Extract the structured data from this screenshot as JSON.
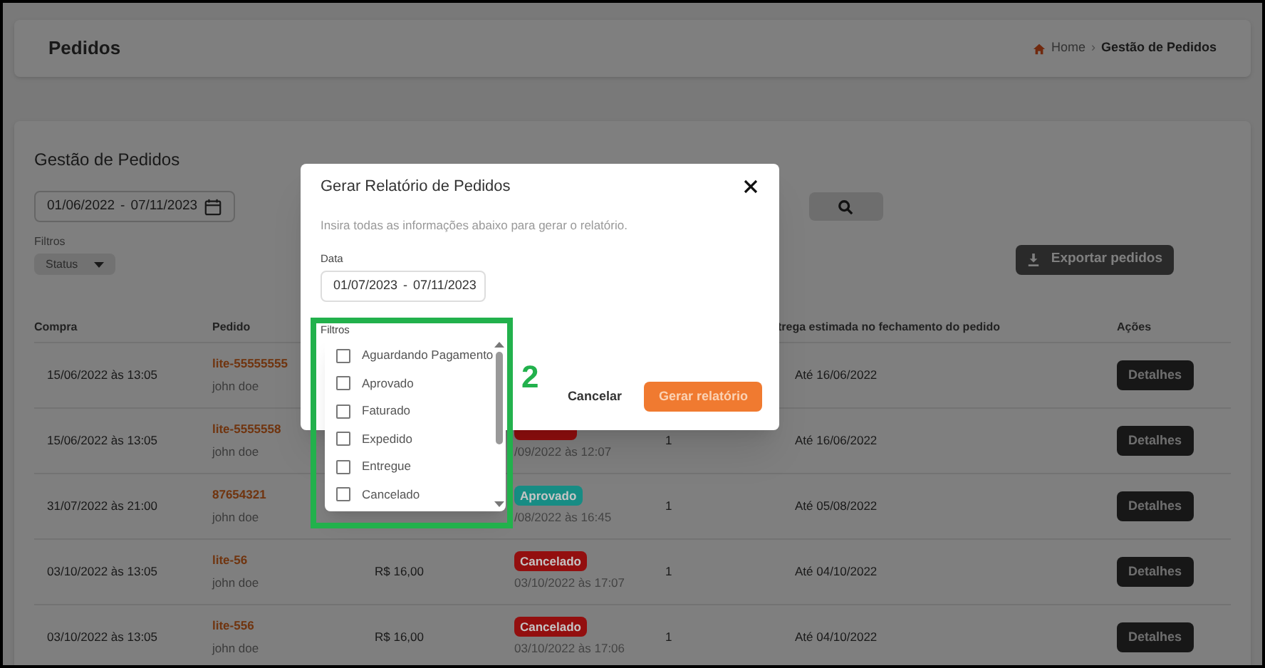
{
  "header": {
    "title": "Pedidos",
    "separator": "›",
    "breadcrumb": [
      {
        "label": "Home",
        "kind": "home"
      },
      {
        "label": "Gestão de Pedidos",
        "kind": "current"
      }
    ]
  },
  "orders": {
    "title": "Gestão de Pedidos",
    "date_range": {
      "start": "01/06/2022",
      "separator": "-",
      "end": "07/11/2023"
    },
    "filters_label": "Filtros",
    "status_select": "Status",
    "export_button": "Exportar pedidos",
    "columns": {
      "column_1": "Compra",
      "column_2": "Pedido",
      "column_6": "trega estimada no fechamento do pedido",
      "column_7": "Ações"
    },
    "rows": [
      {
        "date": "15/06/2022 às 13:05",
        "order": "lite-55555555",
        "customer": "john doe",
        "delivery": "Até 16/06/2022",
        "action": "Detalhes"
      },
      {
        "date": "15/06/2022 às 13:05",
        "order": "lite-5555558",
        "customer": "john doe",
        "status": {
          "color": "#930f0f",
          "date": "/09/2022 às 12:07"
        },
        "quantity": "1",
        "delivery": "Até 16/06/2022",
        "action": "Detalhes"
      },
      {
        "date": "31/07/2022 às 21:00",
        "order": "87654321",
        "customer": "john doe",
        "status": {
          "label": "Aprovado",
          "color": "#178c84",
          "date": "/08/2022 às 16:45"
        },
        "quantity": "1",
        "delivery": "Até 05/08/2022",
        "action": "Detalhes"
      },
      {
        "date": "03/10/2022 às 13:05",
        "order": "lite-56",
        "customer": "john doe",
        "price": "R$ 16,00",
        "status": {
          "label": "Cancelado",
          "color": "#930f0f",
          "date": "03/10/2022 às 17:07"
        },
        "quantity": "1",
        "delivery": "Até 04/10/2022",
        "action": "Detalhes"
      },
      {
        "date": "03/10/2022 às 13:05",
        "order": "lite-556",
        "customer": "john doe",
        "price": "R$ 16,00",
        "status": {
          "label": "Cancelado",
          "color": "#930f0f",
          "date": "03/10/2022 às 17:06"
        },
        "quantity": "1",
        "delivery": "Até 04/10/2022",
        "action": "Detalhes"
      }
    ]
  },
  "dialog": {
    "title": "Gerar Relatório de Pedidos",
    "description": "Insira todas as informações abaixo para gerar o relatório.",
    "date_label": "Data",
    "date_range": {
      "start": "01/07/2023",
      "separator": "-",
      "end": "07/11/2023"
    },
    "filters_label": "Filtros",
    "cancel_button": "Cancelar",
    "submit_button": "Gerar relatório",
    "filter_options": [
      {
        "label": "Aguardando Pagamento",
        "checked": false
      },
      {
        "label": "Aprovado",
        "checked": false
      },
      {
        "label": "Faturado",
        "checked": false
      },
      {
        "label": "Expedido",
        "checked": false
      },
      {
        "label": "Entregue",
        "checked": false
      },
      {
        "label": "Cancelado",
        "checked": false
      }
    ]
  },
  "annotation": {
    "label": "2"
  }
}
